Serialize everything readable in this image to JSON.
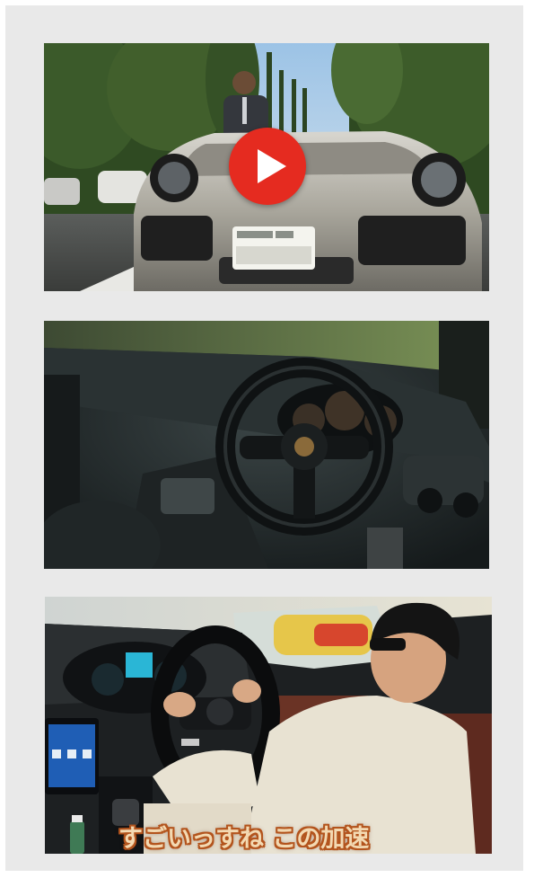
{
  "items": [
    {
      "image": "porsche-911-exterior-with-man",
      "play_icon": "play-icon"
    },
    {
      "image": "porsche-interior-steering-wheel"
    },
    {
      "image": "man-driving-car-interior",
      "caption": "すごいっすね この加速"
    }
  ],
  "colors": {
    "background": "#e9e9e9",
    "play_button": "#e52b20",
    "caption_text": "#f3d9b2",
    "caption_outline": "#b3541d"
  }
}
